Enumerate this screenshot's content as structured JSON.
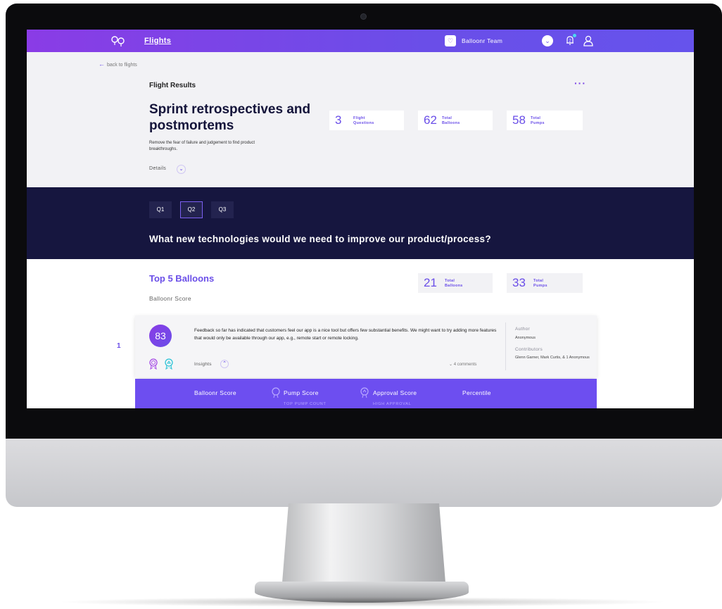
{
  "nav": {
    "flights_label": "Flights",
    "team_name": "Balloonr Team",
    "team_badge": "♡",
    "notification_count": "2"
  },
  "back_link": "back to flights",
  "flight": {
    "section_label": "Flight Results",
    "title": "Sprint retrospectives and postmortems",
    "description": "Remove the fear of failure and judgement to find product breakthroughs.",
    "details_label": "Details",
    "stats": [
      {
        "value": "3",
        "label1": "Flight",
        "label2": "Questions"
      },
      {
        "value": "62",
        "label1": "Total",
        "label2": "Balloons"
      },
      {
        "value": "58",
        "label1": "Total",
        "label2": "Pumps"
      }
    ]
  },
  "questions": {
    "tabs": [
      "Q1",
      "Q2",
      "Q3"
    ],
    "active_tab": "Q2",
    "current_question": "What new technologies would we need to improve our product/process?"
  },
  "balloons": {
    "title": "Top 5 Balloons",
    "subtitle": "Balloonr Score",
    "stats": [
      {
        "value": "21",
        "label1": "Total",
        "label2": "Balloons"
      },
      {
        "value": "33",
        "label1": "Total",
        "label2": "Pumps"
      }
    ],
    "items": [
      {
        "rank": "1",
        "score": "83",
        "text": "Feedback so far has indicated that customers feel our app is a nice tool but offers few substantial benefits. We might want to try adding more features that would only be available through our app, e.g., remote start or remote locking.",
        "insights_label": "Insights",
        "comments": "⌄ 4 comments",
        "author_label": "Author",
        "author": "Anonymous",
        "contributors_label": "Contributors",
        "contributors": "Glenn Garner, Mark Curtis, & 1 Anonymous"
      }
    ]
  },
  "score_bar": {
    "balloonr_score": "Balloonr Score",
    "pump_score": "Pump Score",
    "pump_sub": "TOP PUMP COUNT",
    "approval_score": "Approval Score",
    "approval_sub": "HIGH APPROVAL",
    "percentile": "Percentile"
  },
  "colors": {
    "accent": "#6a4ee8",
    "brand_gradient_start": "#8a3ce6",
    "question_band": "#16163f"
  }
}
